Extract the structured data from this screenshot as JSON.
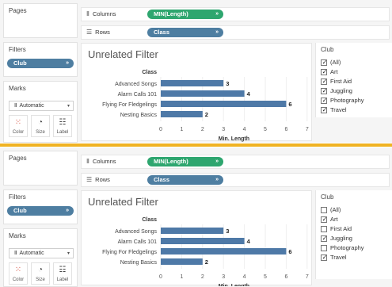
{
  "panels": [
    {
      "id": "top",
      "cards": {
        "pages": "Pages",
        "filters": "Filters",
        "marks": "Marks"
      },
      "filter_pill": "Club",
      "marks": {
        "type": "Automatic",
        "buttons": [
          "Color",
          "Size",
          "Label"
        ]
      },
      "shelves": {
        "columns_label": "Columns",
        "columns_pill": "MIN(Length)",
        "rows_label": "Rows",
        "rows_pill": "Class"
      },
      "viz_title": "Unrelated Filter",
      "legend": {
        "title": "Club",
        "items": [
          {
            "label": "(All)",
            "checked": true
          },
          {
            "label": "Art",
            "checked": true
          },
          {
            "label": "First Aid",
            "checked": true
          },
          {
            "label": "Juggling",
            "checked": true
          },
          {
            "label": "Photography",
            "checked": true
          },
          {
            "label": "Travel",
            "checked": true
          }
        ]
      },
      "chart_data": {
        "type": "bar",
        "orientation": "horizontal",
        "row_header": "Class",
        "categories": [
          "Advanced Songs",
          "Alarm Calls 101",
          "Flying For Fledgelings",
          "Nesting Basics"
        ],
        "values": [
          3,
          4,
          6,
          2
        ],
        "value_labels": [
          "3",
          "4",
          "6",
          "2"
        ],
        "xlabel": "Min. Length",
        "xlim": [
          0,
          7
        ],
        "xticks": [
          0,
          1,
          2,
          3,
          4,
          5,
          6,
          7
        ],
        "bar_color": "#4e79a7"
      }
    },
    {
      "id": "bottom",
      "cards": {
        "pages": "Pages",
        "filters": "Filters",
        "marks": "Marks"
      },
      "filter_pill": "Club",
      "marks": {
        "type": "Automatic",
        "buttons": [
          "Color",
          "Size",
          "Label"
        ]
      },
      "shelves": {
        "columns_label": "Columns",
        "columns_pill": "MIN(Length)",
        "rows_label": "Rows",
        "rows_pill": "Class"
      },
      "viz_title": "Unrelated Filter",
      "legend": {
        "title": "Club",
        "items": [
          {
            "label": "(All)",
            "checked": false
          },
          {
            "label": "Art",
            "checked": true
          },
          {
            "label": "First Aid",
            "checked": false
          },
          {
            "label": "Juggling",
            "checked": true
          },
          {
            "label": "Photography",
            "checked": false
          },
          {
            "label": "Travel",
            "checked": true
          }
        ]
      },
      "chart_data": {
        "type": "bar",
        "orientation": "horizontal",
        "row_header": "Class",
        "categories": [
          "Advanced Songs",
          "Alarm Calls 101",
          "Flying For Fledgelings",
          "Nesting Basics"
        ],
        "values": [
          3,
          4,
          6,
          2
        ],
        "value_labels": [
          "3",
          "4",
          "6",
          "2"
        ],
        "xlabel": "Min. Length",
        "xlim": [
          0,
          7
        ],
        "xticks": [
          0,
          1,
          2,
          3,
          4,
          5,
          6,
          7
        ],
        "bar_color": "#4e79a7"
      }
    }
  ],
  "colors": {
    "accent_separator": "#f0b323",
    "pill_dimension": "#4e7ea1",
    "pill_measure": "#2ea66f",
    "bar": "#4e79a7"
  },
  "icons": {
    "columns": "columns-icon",
    "rows": "rows-icon",
    "marks_type": "bar-chart-icon",
    "color": "color-dots-icon",
    "size": "size-icon",
    "label": "label-icon"
  }
}
